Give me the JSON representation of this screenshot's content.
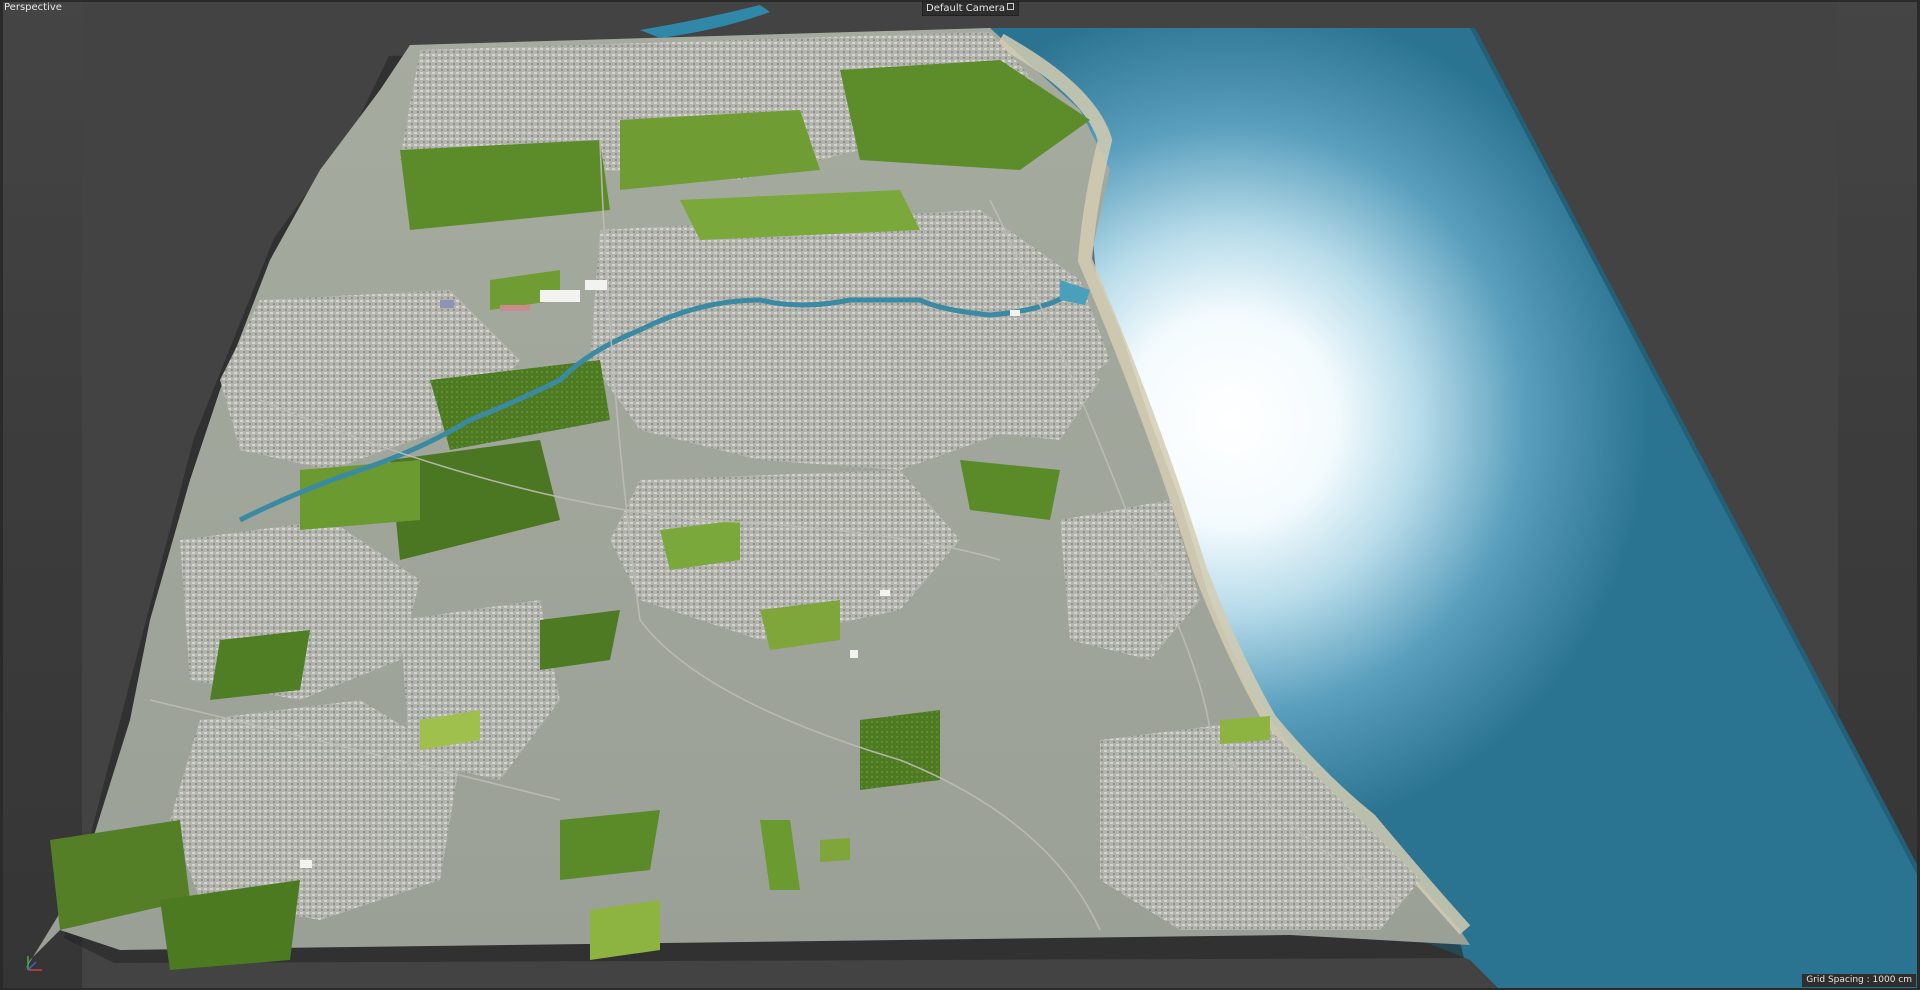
{
  "viewport": {
    "view_name": "Perspective",
    "camera_name": "Default Camera",
    "grid_spacing": "Grid Spacing : 1000 cm"
  },
  "colors": {
    "background": "#3a3a3a",
    "sea": "#2a7391",
    "sea_glow": "#ffffff",
    "terrain": "#9ea59a",
    "urban": "#b8bab4",
    "woodland": "#4f7e24",
    "field": "#7fa83c",
    "river": "#3a8aa3",
    "beach": "#cfc7ad"
  },
  "icons": [
    "camera-icon",
    "axis-gizmo-icon"
  ]
}
